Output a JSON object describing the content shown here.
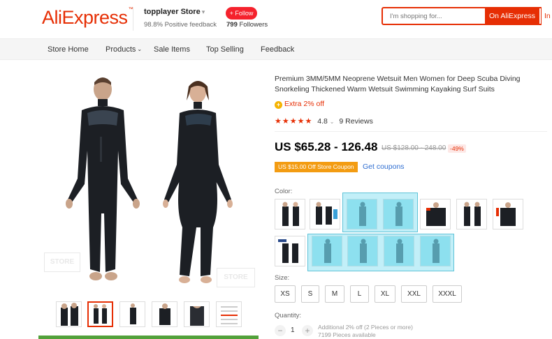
{
  "header": {
    "logo": "AliExpress",
    "store_name": "topplayer Store",
    "feedback": "98.8% Positive feedback",
    "follow_label": "+ Follow",
    "followers_count": "799",
    "followers_label": "Followers",
    "search_placeholder": "I'm shopping for...",
    "search_button": "On AliExpress",
    "search_button2": "In this store"
  },
  "nav": {
    "items": [
      "Store Home",
      "Products",
      "Sale Items",
      "Top Selling",
      "Feedback"
    ]
  },
  "gallery": {
    "watermark": "STORE"
  },
  "product": {
    "title": "Premium 3MM/5MM Neoprene Wetsuit Men Women for Deep Scuba Diving Snorkeling Thickened Warm Wetsuit Swimming Kayaking Surf Suits",
    "extra_off": "Extra 2% off",
    "rating": "4.8",
    "reviews": "9 Reviews",
    "price": "US $65.28 - 126.48",
    "old_price": "US $128.00 - 248.00",
    "discount": "-49%",
    "coupon": "US $15.00 Off Store Coupon",
    "get_coupons": "Get coupons",
    "color_label": "Color:",
    "size_label": "Size:",
    "sizes": [
      "XS",
      "S",
      "M",
      "L",
      "XL",
      "XXL",
      "XXXL"
    ],
    "quantity_label": "Quantity:",
    "quantity": "1",
    "qty_note1": "Additional 2% off (2 Pieces or more)",
    "qty_note2": "7199 Pieces available"
  },
  "colors": {
    "accent": "#e62e04",
    "suit": "#1c1f24",
    "highlight": "#78dcf0"
  }
}
